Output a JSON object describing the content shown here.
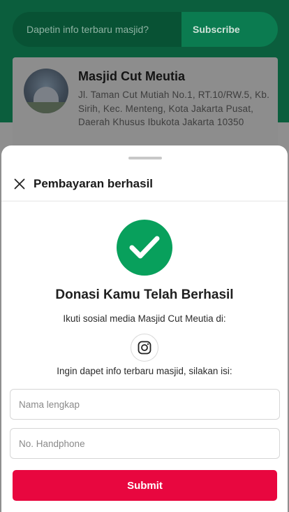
{
  "background": {
    "subscribe": {
      "placeholder": "Dapetin info terbaru masjid?",
      "button_label": "Subscribe"
    },
    "mosque": {
      "name": "Masjid Cut Meutia",
      "address": "Jl. Taman Cut Mutiah No.1, RT.10/RW.5, Kb. Sirih, Kec. Menteng, Kota Jakarta Pusat, Daerah Khusus Ibukota Jakarta 10350"
    }
  },
  "sheet": {
    "title": "Pembayaran berhasil",
    "success_title": "Donasi Kamu Telah Berhasil",
    "social_text": "Ikuti sosial media Masjid Cut Meutia di:",
    "info_text": "Ingin dapet info terbaru masjid, silakan isi:",
    "name_placeholder": "Nama lengkap",
    "phone_placeholder": "No. Handphone",
    "submit_label": "Submit"
  },
  "colors": {
    "brand_green": "#08a05c",
    "submit_red": "#e8073f"
  },
  "icons": [
    "close-icon",
    "check-icon",
    "instagram-icon"
  ]
}
